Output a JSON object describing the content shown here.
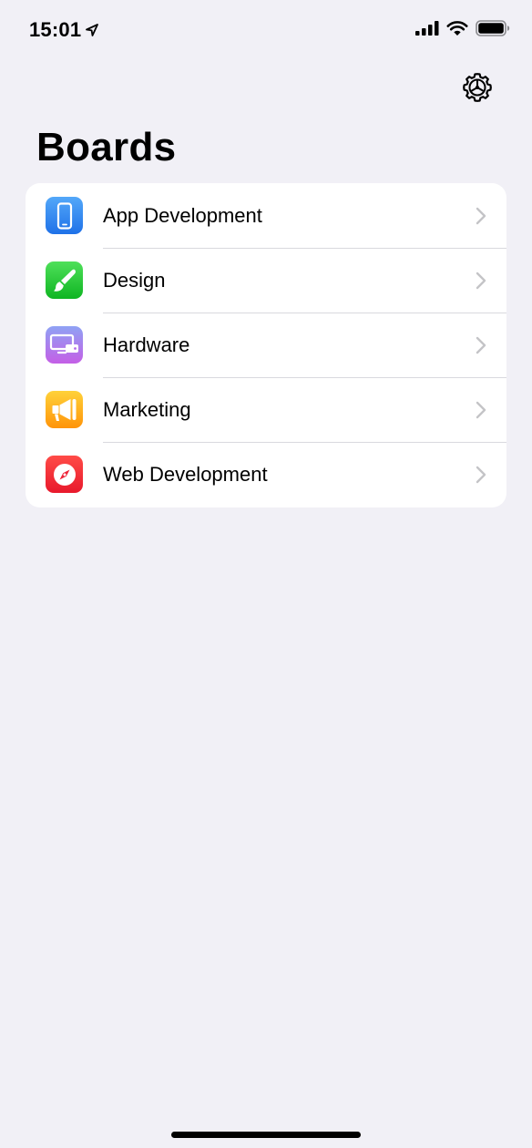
{
  "status_bar": {
    "time": "15:01",
    "icons": [
      "location-arrow-icon",
      "cellular-signal-icon",
      "wifi-icon",
      "battery-icon"
    ]
  },
  "nav": {
    "title": "Boards",
    "settings_icon": "gear-icon"
  },
  "boards": [
    {
      "label": "App Development",
      "icon": "phone-icon",
      "color": "#2f86f0"
    },
    {
      "label": "Design",
      "icon": "paintbrush-icon",
      "color": "#1ec636"
    },
    {
      "label": "Hardware",
      "icon": "display-icon",
      "color": "#b077ec"
    },
    {
      "label": "Marketing",
      "icon": "megaphone-icon",
      "color": "#ffad1a"
    },
    {
      "label": "Web Development",
      "icon": "compass-icon",
      "color": "#f4283a"
    }
  ],
  "colors": {
    "background": "#f1f0f6",
    "card": "#ffffff",
    "separator": "#d9d9de",
    "chevron": "#c4c4c7"
  }
}
